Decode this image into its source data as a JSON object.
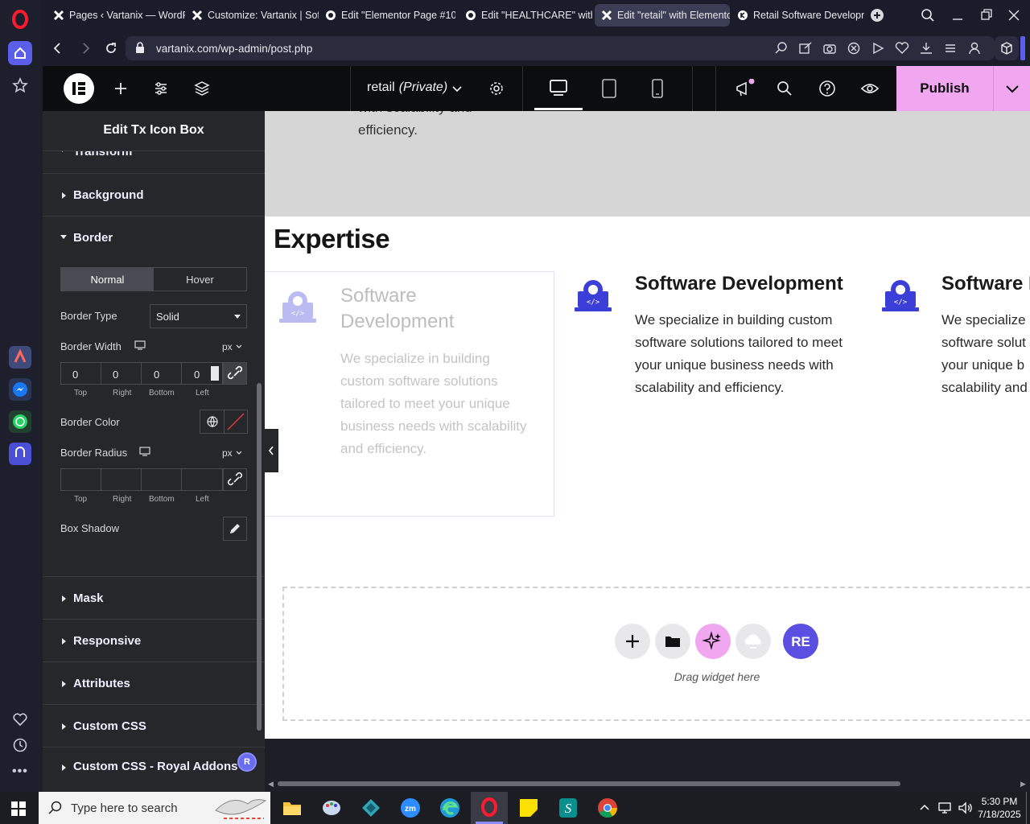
{
  "browser": {
    "tabs": [
      {
        "label": "Pages ‹ Vartanix — WordF",
        "icon": "elementor-x-icon"
      },
      {
        "label": "Customize: Vartanix | Soft",
        "icon": "elementor-x-icon"
      },
      {
        "label": "Edit \"Elementor Page #10",
        "icon": "globe-icon"
      },
      {
        "label": "Edit \"HEALTHCARE\" with E",
        "icon": "globe-icon"
      },
      {
        "label": "Edit \"retail\" with Elemento",
        "icon": "elementor-x-icon"
      },
      {
        "label": "Retail Software Developm",
        "icon": "site-icon"
      }
    ],
    "url": "vartanix.com/wp-admin/post.php"
  },
  "editor": {
    "page_title": "retail",
    "page_status": "(Private)",
    "publish_label": "Publish",
    "panel_title": "Edit Tx Icon Box"
  },
  "panel": {
    "sections_top": [
      "Transform",
      "Background",
      "Border"
    ],
    "state_tabs": [
      "Normal",
      "Hover"
    ],
    "border_type_label": "Border Type",
    "border_type_value": "Solid",
    "border_width_label": "Border Width",
    "unit": "px",
    "border_width_values": [
      "0",
      "0",
      "0",
      "0"
    ],
    "dim_labels": [
      "Top",
      "Right",
      "Bottom",
      "Left"
    ],
    "border_color_label": "Border Color",
    "border_radius_label": "Border Radius",
    "box_shadow_label": "Box Shadow",
    "sections_bottom": [
      "Mask",
      "Responsive",
      "Attributes",
      "Custom CSS",
      "Custom CSS - Royal Addons"
    ],
    "badge": "R"
  },
  "canvas": {
    "top_text_partial": "with scalability and",
    "top_text_last": "efficiency.",
    "heading": "Expertise",
    "card_title": "Software Development",
    "card_title_line1": "Software",
    "card_title_line2": "Development",
    "card_faded_lines": [
      "We specialize in building",
      "custom software solutions",
      "tailored to meet your unique",
      "business needs with scalability",
      "and efficiency."
    ],
    "card_lines": [
      "We specialize in building custom",
      "software solutions tailored to meet",
      "your unique business needs with",
      "scalability and efficiency."
    ],
    "card3_title": "Software D",
    "card3_lines": [
      "We specialize",
      "software solut",
      "your unique b",
      "scalability and"
    ],
    "drop_hint": "Drag widget here"
  },
  "taskbar": {
    "search_placeholder": "Type here to search",
    "time": "5:30 PM",
    "date": "7/18/2025"
  },
  "colors": {
    "accent_blue": "#3b3fd8",
    "publish_bg": "#f0a7f0",
    "panel_bg": "#26272b",
    "canvas_gray": "#d6d6d6"
  }
}
